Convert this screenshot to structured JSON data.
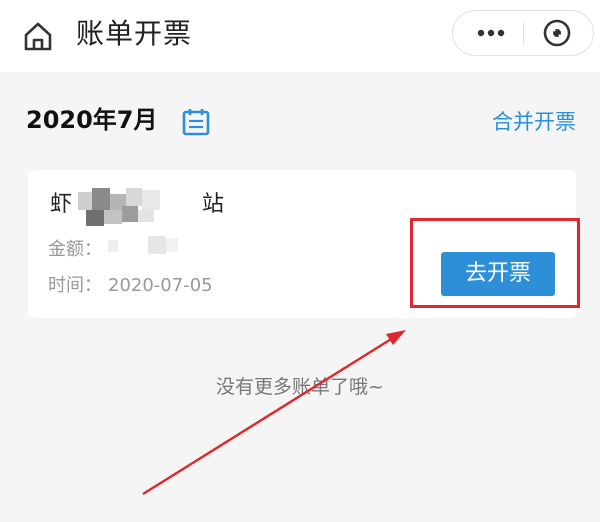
{
  "header": {
    "title": "账单开票",
    "home_icon": "home-icon",
    "more_icon": "more-icon",
    "close_icon": "close-circle-icon"
  },
  "period": {
    "month_label": "2020年7月",
    "calendar_icon": "calendar-icon",
    "merge_label": "合并开票"
  },
  "bill": {
    "merchant_prefix": "虾",
    "merchant_suffix": "站",
    "amount_label": "金额：",
    "time_label": "时间：",
    "time_value": "2020-07-05",
    "action_label": "去开票"
  },
  "footer": {
    "end_text": "没有更多账单了哦~"
  },
  "colors": {
    "accent": "#2c8fd8",
    "annotation": "#e0272b"
  }
}
